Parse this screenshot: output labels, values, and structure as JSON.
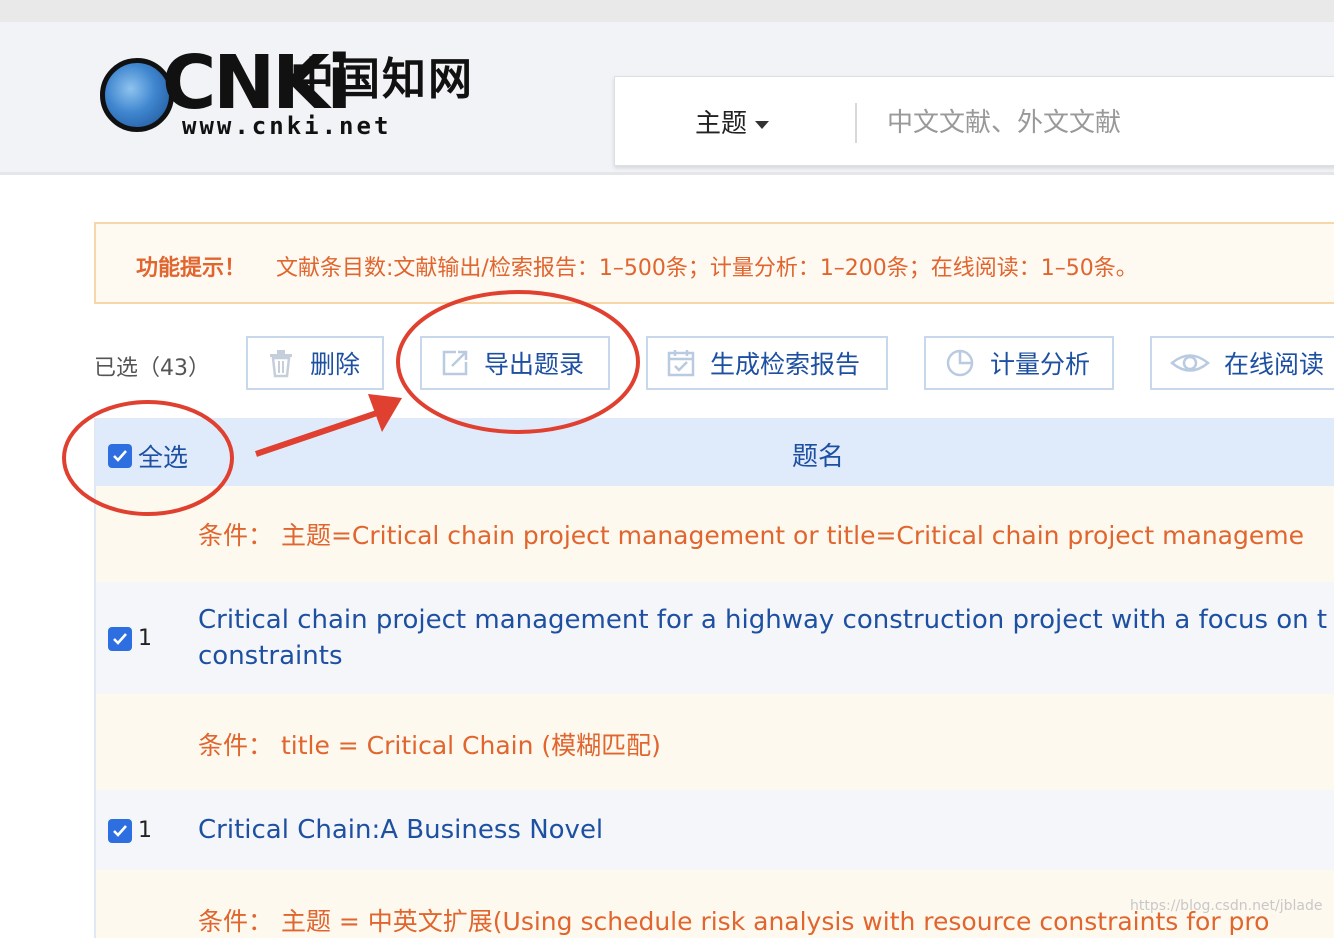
{
  "header": {
    "logo": {
      "brand": "CNKi",
      "cn_name": "中国知网",
      "url": "www.cnki.net"
    },
    "search": {
      "field_label": "主题",
      "placeholder": "中文文献、外文文献"
    }
  },
  "tip": {
    "label": "功能提示！",
    "text": "文献条目数:文献输出/检索报告：1–500条；计量分析：1–200条；在线阅读：1–50条。"
  },
  "toolbar": {
    "selected": "已选（43）",
    "buttons": [
      {
        "label": "删除",
        "icon": "trash-icon"
      },
      {
        "label": "导出题录",
        "icon": "export-icon"
      },
      {
        "label": "生成检索报告",
        "icon": "report-icon"
      },
      {
        "label": "计量分析",
        "icon": "pie-chart-icon"
      },
      {
        "label": "在线阅读",
        "icon": "eye-icon"
      }
    ]
  },
  "table": {
    "select_all": "全选",
    "title_header": "题名",
    "rows": [
      {
        "type": "condition",
        "text": "条件：  主题=Critical chain project management or title=Critical chain project manageme"
      },
      {
        "type": "item",
        "number": "1",
        "title": "Critical chain project management for a highway construction project with a focus on t constraints"
      },
      {
        "type": "condition",
        "text": "条件：  title = Critical Chain (模糊匹配)"
      },
      {
        "type": "item",
        "number": "1",
        "title": "Critical Chain:A Business Novel"
      },
      {
        "type": "condition",
        "text": "条件：  主题 = 中英文扩展(Using schedule risk analysis with resource constraints for pro"
      }
    ]
  },
  "annotations": {
    "color": "#e0402f"
  },
  "watermark": "https://blog.csdn.net/jblade"
}
